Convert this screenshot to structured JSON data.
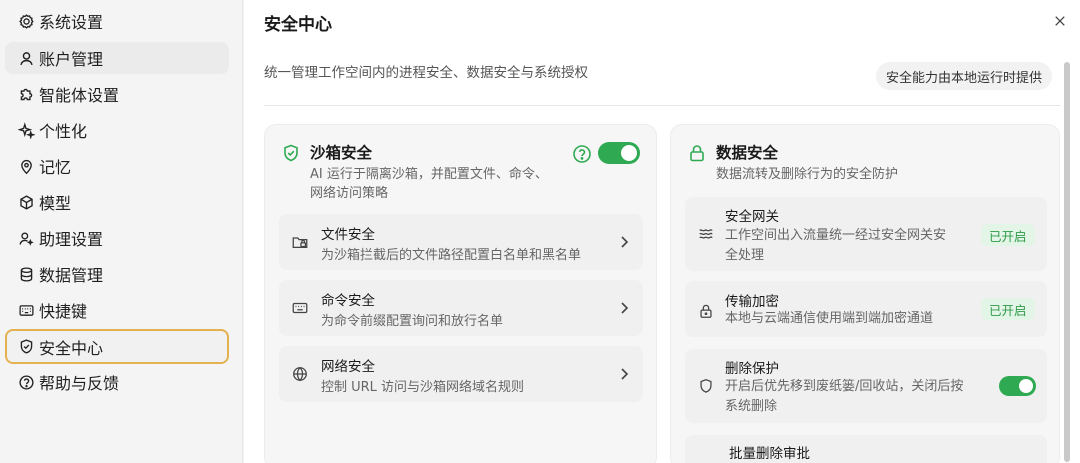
{
  "sidebar": {
    "items": [
      {
        "label": "系统设置",
        "icon": "gear-icon"
      },
      {
        "label": "账户管理",
        "icon": "user-icon"
      },
      {
        "label": "智能体设置",
        "icon": "puzzle-icon"
      },
      {
        "label": "个性化",
        "icon": "sparkle-icon"
      },
      {
        "label": "记忆",
        "icon": "location-pin-icon"
      },
      {
        "label": "模型",
        "icon": "cube-icon"
      },
      {
        "label": "助理设置",
        "icon": "assistant-icon"
      },
      {
        "label": "数据管理",
        "icon": "database-icon"
      },
      {
        "label": "快捷键",
        "icon": "keyboard-icon"
      },
      {
        "label": "安全中心",
        "icon": "shield-icon"
      },
      {
        "label": "帮助与反馈",
        "icon": "question-icon"
      }
    ]
  },
  "header": {
    "title": "安全中心",
    "subtitle": "统一管理工作空间内的进程安全、数据安全与系统授权",
    "badge": "安全能力由本地运行时提供"
  },
  "sandbox": {
    "title": "沙箱安全",
    "desc_line1": "AI 运行于隔离沙箱，并配置文件、命令、",
    "desc_line2": "网络访问策略",
    "enabled": true,
    "rows": [
      {
        "title": "文件安全",
        "desc": "为沙箱拦截后的文件路径配置白名单和黑名单",
        "icon": "folder-lock-icon"
      },
      {
        "title": "命令安全",
        "desc": "为命令前缀配置询问和放行名单",
        "icon": "keyboard-icon"
      },
      {
        "title": "网络安全",
        "desc": "控制 URL 访问与沙箱网络域名规则",
        "icon": "globe-icon"
      }
    ]
  },
  "data_security": {
    "title": "数据安全",
    "desc": "数据流转及删除行为的安全防护",
    "gateway": {
      "title": "安全网关",
      "desc_line1": "工作空间出入流量统一经过安全网关安",
      "desc_line2": "全处理",
      "status": "已开启"
    },
    "encryption": {
      "title": "传输加密",
      "desc": "本地与云端通信使用端到端加密通道",
      "status": "已开启"
    },
    "delete_protect": {
      "title": "删除保护",
      "desc_line1": "开启后优先移到废纸篓/回收站，关闭后按",
      "desc_line2": "系统删除",
      "enabled": true
    },
    "batch_delete": {
      "title": "批量删除审批"
    }
  },
  "colors": {
    "accent_green": "#2faa53",
    "active_border": "#e3b14f",
    "status_bg": "#e3f5e6"
  }
}
